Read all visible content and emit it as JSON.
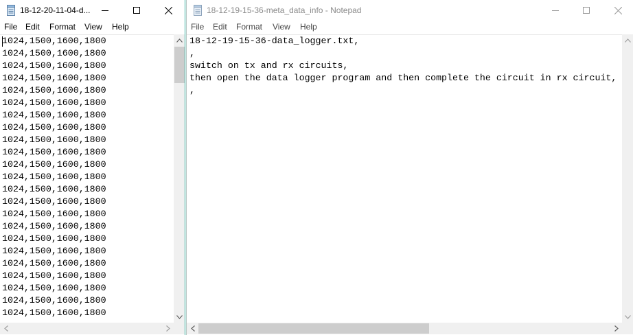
{
  "left_window": {
    "title": "18-12-20-11-04-d...",
    "menu": [
      "File",
      "Edit",
      "Format",
      "View",
      "Help"
    ],
    "lines": [
      "1024,1500,1600,1800",
      "1024,1500,1600,1800",
      "1024,1500,1600,1800",
      "1024,1500,1600,1800",
      "1024,1500,1600,1800",
      "1024,1500,1600,1800",
      "1024,1500,1600,1800",
      "1024,1500,1600,1800",
      "1024,1500,1600,1800",
      "1024,1500,1600,1800",
      "1024,1500,1600,1800",
      "1024,1500,1600,1800",
      "1024,1500,1600,1800",
      "1024,1500,1600,1800",
      "1024,1500,1600,1800",
      "1024,1500,1600,1800",
      "1024,1500,1600,1800",
      "1024,1500,1600,1800",
      "1024,1500,1600,1800",
      "1024,1500,1600,1800",
      "1024,1500,1600,1800",
      "1024,1500,1600,1800",
      "1024,1500,1600,1800"
    ]
  },
  "right_window": {
    "title": "18-12-19-15-36-meta_data_info - Notepad",
    "menu": [
      "File",
      "Edit",
      "Format",
      "View",
      "Help"
    ],
    "lines": [
      "18-12-19-15-36-data_logger.txt,",
      ",",
      "switch on tx and rx circuits,",
      "then open the data logger program and then complete the circuit in rx circuit,",
      ","
    ]
  },
  "icons": {
    "app": "notepad-icon",
    "minimize": "minimize-icon",
    "maximize": "maximize-icon",
    "close": "close-icon"
  },
  "colors": {
    "active_border": "#38b0a0",
    "inactive_title": "#8a8a8a",
    "scrollbar_track": "#f0f0f0",
    "scrollbar_thumb": "#cdcdcd"
  }
}
